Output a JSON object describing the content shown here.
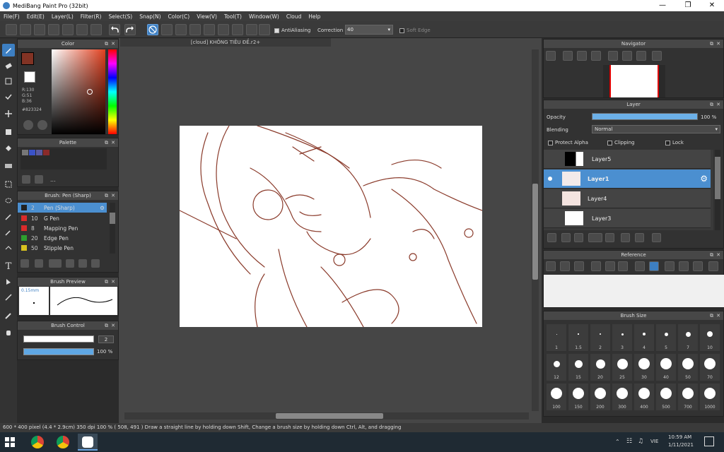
{
  "app": {
    "title": "MediBang Paint Pro (32bit)"
  },
  "menu": [
    "File(F)",
    "Edit(E)",
    "Layer(L)",
    "Filter(R)",
    "Select(S)",
    "Snap(N)",
    "Color(C)",
    "View(V)",
    "Tool(T)",
    "Window(W)",
    "Cloud",
    "Help"
  ],
  "toolbar": {
    "antialiasing": "AntiAliasing",
    "correction_label": "Correction",
    "correction_value": "40",
    "soft_edge": "Soft Edge"
  },
  "color_panel": {
    "title": "Color",
    "r": "R:130",
    "g": "G:51",
    "b": "B:36",
    "hex": "#823324",
    "main_color": "#823324"
  },
  "palette_panel": {
    "title": "Palette",
    "more": "..."
  },
  "brush_panel": {
    "title": "Brush: Pen (Sharp)",
    "items": [
      {
        "num": "2",
        "name": "Pen (Sharp)",
        "color": "#222222"
      },
      {
        "num": "10",
        "name": "G Pen",
        "color": "#d92b2b"
      },
      {
        "num": "8",
        "name": "Mapping Pen",
        "color": "#d92b2b"
      },
      {
        "num": "20",
        "name": "Edge Pen",
        "color": "#2e9e2e"
      },
      {
        "num": "50",
        "name": "Stipple Pen",
        "color": "#d8c21f"
      }
    ]
  },
  "brush_preview": {
    "title": "Brush Preview",
    "size": "0.15mm"
  },
  "brush_control": {
    "title": "Brush Control",
    "size_value": "2",
    "opacity_value": "100 %"
  },
  "document": {
    "tab": "[cloud] KHÔNG TIÊU ĐỀ.r2+"
  },
  "navigator": {
    "title": "Navigator"
  },
  "layer_panel": {
    "title": "Layer",
    "opacity_label": "Opacity",
    "opacity_value": "100 %",
    "opacity_fraction": 1.0,
    "blending_label": "Blending",
    "blending_value": "Normal",
    "protect_alpha": "Protect Alpha",
    "clipping": "Clipping",
    "lock": "Lock",
    "layers": [
      {
        "name": "Layer5"
      },
      {
        "name": "Layer1"
      },
      {
        "name": "Layer4"
      },
      {
        "name": "Layer3"
      }
    ]
  },
  "reference": {
    "title": "Reference"
  },
  "brush_size": {
    "title": "Brush Size",
    "sizes": [
      "1",
      "1.5",
      "2",
      "3",
      "4",
      "5",
      "7",
      "10",
      "12",
      "15",
      "20",
      "25",
      "30",
      "40",
      "50",
      "70",
      "100",
      "150",
      "200",
      "300",
      "400",
      "500",
      "700",
      "1000"
    ]
  },
  "status": {
    "text": "600 * 400 pixel  (4.4 * 2.9cm)  350 dpi  100 %  ( 508, 491 )  Draw a straight line by holding down Shift, Change a brush size by holding down Ctrl, Alt, and dragging"
  },
  "taskbar": {
    "lang": "VIE",
    "time": "10:59 AM",
    "date": "1/11/2021"
  }
}
